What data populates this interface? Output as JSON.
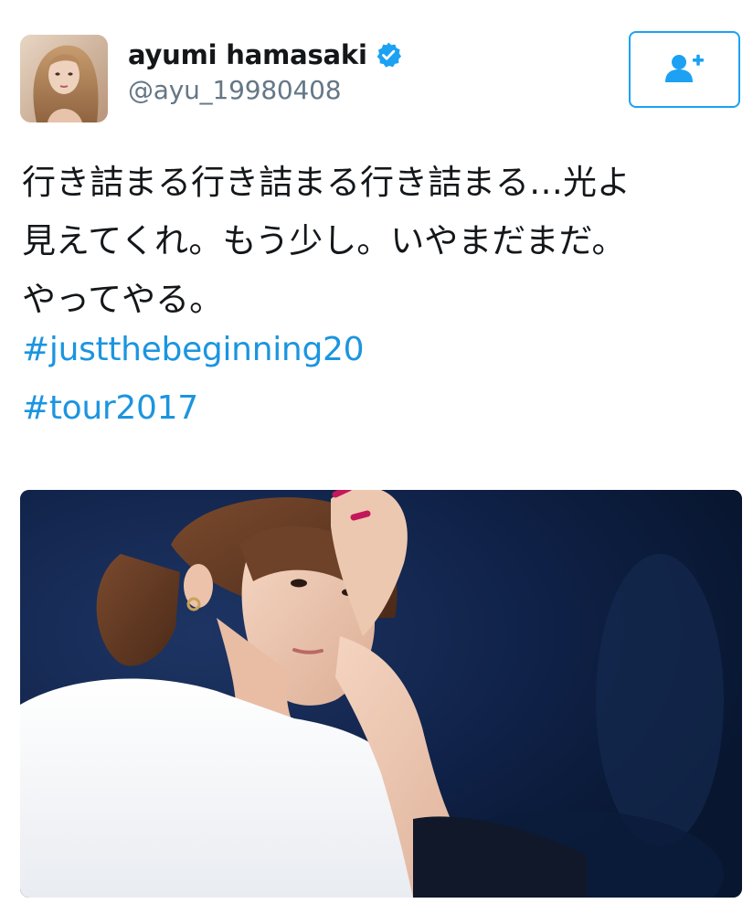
{
  "user": {
    "display_name": "ayumi hamasaki",
    "handle": "@ayu_19980408",
    "verified": true,
    "avatar_icon": "profile-photo"
  },
  "follow_button": {
    "icon": "add-user-icon"
  },
  "tweet": {
    "text_lines": [
      "行き詰まる行き詰まる行き詰まる…光よ",
      "見えてくれ。もう少し。いやまだまだ。",
      "やってやる。"
    ],
    "hashtags": [
      "#justthebeginning20",
      "#tour2017"
    ]
  },
  "media": {
    "type": "photo"
  },
  "colors": {
    "accent": "#1da1f2",
    "hashtag": "#1b95e0",
    "verified_badge": "#1da1f2",
    "text_primary": "#14171a",
    "text_secondary": "#657786"
  }
}
